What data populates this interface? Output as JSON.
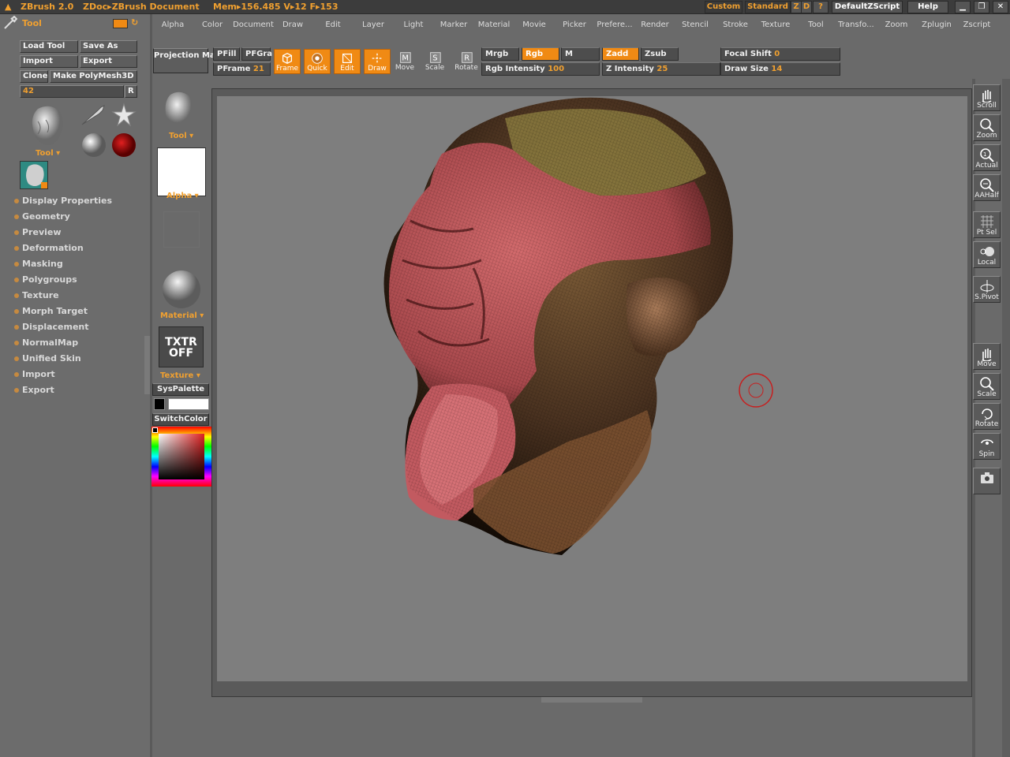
{
  "titlebar": {
    "app_title": "ZBrush 2.0",
    "doc_title": "ZDoc▸ZBrush Document",
    "stats": "Mem▸156.485  V▸12  F▸153",
    "custom": "Custom",
    "standard": "Standard",
    "z": "Z",
    "d": "D",
    "help_q": "?",
    "zscript": "DefaultZScript",
    "help": "Help",
    "minimize": "▁",
    "restore": "❐",
    "close": "✕"
  },
  "menubar": [
    "Alpha",
    "Color",
    "Document",
    "Draw",
    "Edit",
    "Layer",
    "Light",
    "Marker",
    "Material",
    "Movie",
    "Picker",
    "Prefere...",
    "Render",
    "Stencil",
    "Stroke",
    "Texture",
    "Tool",
    "Transfo...",
    "Zoom",
    "Zplugin",
    "Zscript"
  ],
  "left_panel": {
    "heading": "Tool",
    "load_tool": "Load Tool",
    "save_as": "Save As",
    "import": "Import",
    "export": "Export",
    "clone": "Clone",
    "make_polymesh": "Make PolyMesh3D",
    "value": "42",
    "r_button": "R",
    "tool_label": "Tool",
    "subpalettes": [
      "Display Properties",
      "Geometry",
      "Preview",
      "Deformation",
      "Masking",
      "Polygroups",
      "Texture",
      "Morph Target",
      "Displacement",
      "NormalMap",
      "Unified Skin",
      "Import",
      "Export"
    ]
  },
  "middle": {
    "projection_master": "Projection Master",
    "tool_label": "Tool",
    "alpha_label": "Alpha",
    "material_label": "Material",
    "txtr_off_line1": "TXTR",
    "txtr_off_line2": "OFF",
    "texture_label": "Texture",
    "syspalette": "SysPalette",
    "switchcolor": "SwitchColor"
  },
  "shelf": {
    "pfill": "PFill",
    "pfgra": "PFGra",
    "pframe": "PFrame",
    "pframe_value": "21",
    "tools": [
      {
        "label": "Frame",
        "icon": "cube-icon",
        "active": true
      },
      {
        "label": "Quick",
        "icon": "quick-icon",
        "active": true
      },
      {
        "label": "Edit",
        "icon": "edit-icon",
        "active": true
      },
      {
        "label": "Draw",
        "icon": "draw-icon",
        "active": true
      },
      {
        "label": "Move",
        "icon": "move-icon",
        "active": false
      },
      {
        "label": "Scale",
        "icon": "scale-icon",
        "active": false
      },
      {
        "label": "Rotate",
        "icon": "rotate-icon",
        "active": false
      }
    ],
    "mrgb": "Mrgb",
    "rgb": "Rgb",
    "m": "M",
    "rgb_intensity": "Rgb Intensity",
    "rgb_intensity_value": "100",
    "zadd": "Zadd",
    "zsub": "Zsub",
    "z_intensity": "Z Intensity",
    "z_intensity_value": "25",
    "focal_shift": "Focal Shift",
    "focal_shift_value": "0",
    "draw_size": "Draw Size",
    "draw_size_value": "14"
  },
  "right_tools": [
    {
      "label": "Scroll",
      "icon": "hand-icon"
    },
    {
      "label": "Zoom",
      "icon": "zoom-icon"
    },
    {
      "label": "Actual",
      "icon": "actual-icon"
    },
    {
      "label": "AAHalf",
      "icon": "aahalf-icon"
    },
    {
      "label": "Pt Sel",
      "icon": "ptsel-icon"
    },
    {
      "label": "Local",
      "icon": "local-icon"
    },
    {
      "label": "S.Pivot",
      "icon": "spivot-icon"
    },
    {
      "label": "Move",
      "icon": "hand-icon"
    },
    {
      "label": "Scale",
      "icon": "zoom-icon"
    },
    {
      "label": "Rotate",
      "icon": "rotate-icon"
    },
    {
      "label": "Spin",
      "icon": "spin-icon"
    },
    {
      "label": "",
      "icon": "camera-icon"
    }
  ],
  "colors": {
    "accent": "#f08a14",
    "label_orange": "#f0a030",
    "panel_bg": "#6c6c6c",
    "canvas_bg": "#7e7e7e",
    "model_red": "#c4565a",
    "model_brown": "#6a4a32",
    "brush_cursor": "#c62020"
  }
}
